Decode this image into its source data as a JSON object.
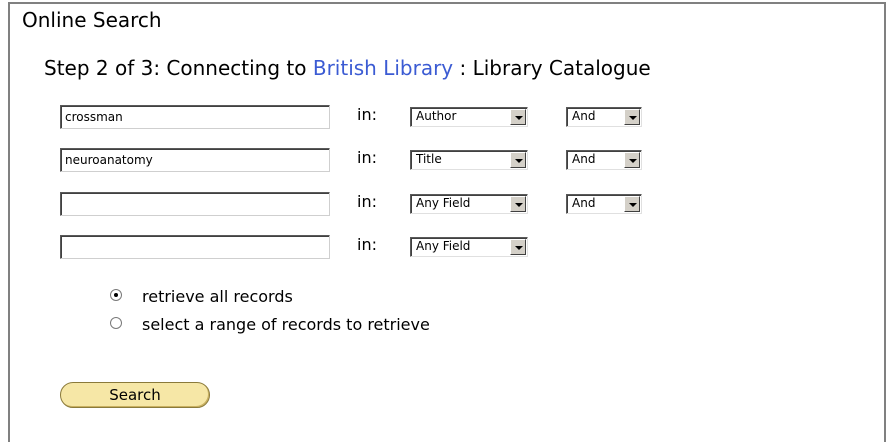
{
  "panel": {
    "title": "Online Search"
  },
  "step": {
    "prefix": "Step 2 of 3: Connecting to",
    "library": "British Library",
    "suffix": ": Library Catalogue"
  },
  "rows": [
    {
      "term": "crossman",
      "in_label": "in:",
      "field": "Author",
      "operator": "And"
    },
    {
      "term": "neuroanatomy",
      "in_label": "in:",
      "field": "Title",
      "operator": "And"
    },
    {
      "term": "",
      "in_label": "in:",
      "field": "Any Field",
      "operator": "And"
    },
    {
      "term": "",
      "in_label": "in:",
      "field": "Any Field"
    }
  ],
  "retrieve": {
    "all_label": "retrieve all records",
    "range_label": "select a range of records to retrieve",
    "selected": "all"
  },
  "search_button": "Search",
  "colors": {
    "link": "#3b5bd3",
    "button_fill": "#f6e7a6"
  }
}
